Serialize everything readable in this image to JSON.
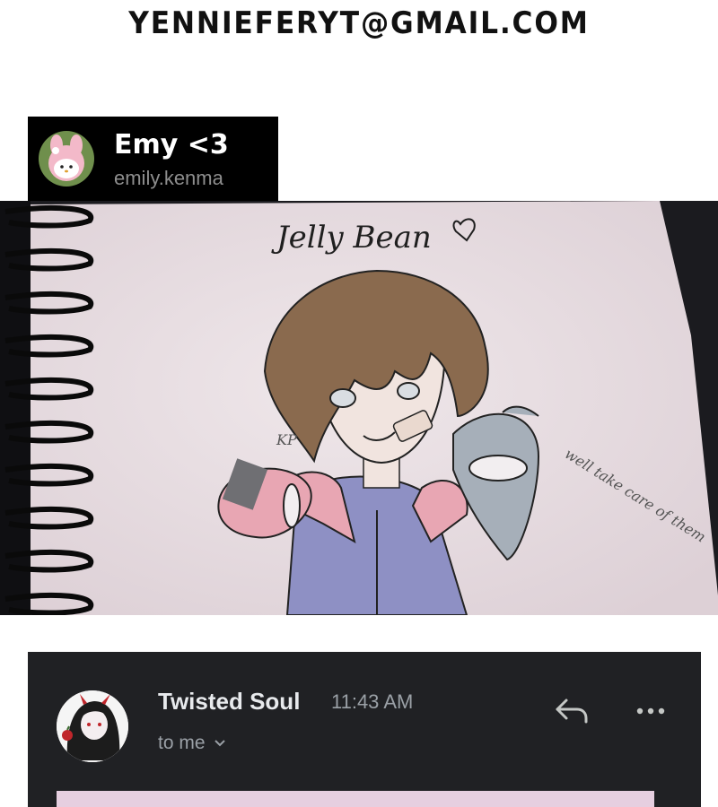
{
  "header": {
    "email": "YENNIEFERYT@GMAIL.COM"
  },
  "profile": {
    "name": "Emy <3",
    "handle": "emily.kenma",
    "avatar_icon": "my-melody-avatar"
  },
  "drawing": {
    "title": "Jelly Bean",
    "side_note": "well take care of them",
    "signature": "KP",
    "paper_color": "#ece3e6",
    "accent_colors": {
      "hair": "#8a6a4e",
      "hood": "#e8a6b3",
      "jacket": "#8e90c4",
      "bean": "#a6afb9"
    }
  },
  "email": {
    "sender_name": "Twisted Soul",
    "time": "11:43 AM",
    "recipient": "to me",
    "reply_icon": "reply-icon",
    "more_icon": "more-horizontal-icon",
    "preview_color": "#e6cfe0"
  }
}
